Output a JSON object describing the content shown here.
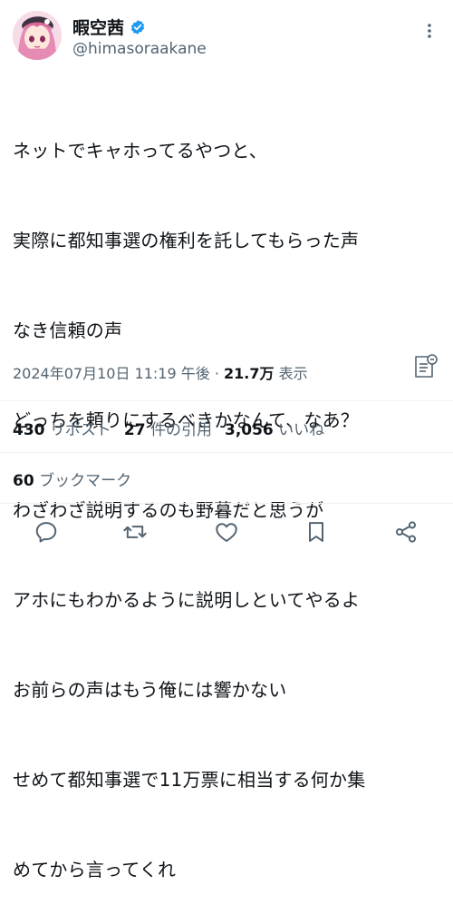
{
  "author": {
    "name": "暇空茜",
    "handle": "@himasoraakane",
    "avatar_icon": "avatar-anime-girl-icon",
    "verified_icon": "verified-badge-icon",
    "verified_color": "#1d9bf0"
  },
  "tweet": {
    "lines": [
      "ネットでキャホってるやつと、",
      "実際に都知事選の権利を託してもらった声",
      "なき信頼の声",
      "どっちを頼りにするべきかなんて、なあ？",
      "わざわざ説明するのも野暮だと思うが",
      "アホにもわかるように説明しといてやるよ",
      "お前らの声はもう俺には響かない",
      "せめて都知事選で11万票に相当する何か集",
      "めてから言ってくれ"
    ]
  },
  "meta": {
    "timestamp": "2024年07月10日 11:19 午後",
    "separator": " · ",
    "views_count": "21.7万",
    "views_label": " 表示"
  },
  "stats": {
    "reposts_count": "430",
    "reposts_label": "リポスト",
    "quotes_count": "27",
    "quotes_label": "件の引用",
    "likes_count": "3,056",
    "likes_label": "いいね",
    "bookmarks_count": "60",
    "bookmarks_label": "ブックマーク"
  },
  "actions": {
    "reply_icon": "reply-icon",
    "repost_icon": "repost-icon",
    "like_icon": "heart-icon",
    "bookmark_icon": "bookmark-icon",
    "share_icon": "share-icon",
    "icon_color": "#536471"
  }
}
